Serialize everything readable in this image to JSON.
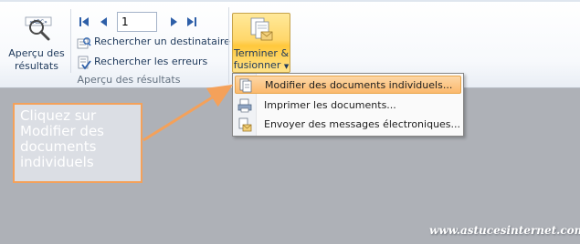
{
  "ribbon": {
    "apercu_button": {
      "line1": "Aperçu des",
      "line2": "résultats",
      "icon_text": "«ABC»"
    },
    "nav": {
      "record_value": "1"
    },
    "rechercher_destinataire": "Rechercher un destinataire",
    "rechercher_erreurs": "Rechercher les erreurs",
    "group_label": "Aperçu des résultats",
    "terminer_button": {
      "line1": "Terminer &",
      "line2": "fusionner"
    }
  },
  "dropdown": {
    "items": [
      {
        "label": "Modifier des documents individuels...",
        "icon": "edit-documents-icon",
        "highlighted": true
      },
      {
        "label": "Imprimer les documents...",
        "icon": "print-documents-icon",
        "highlighted": false
      },
      {
        "label": "Envoyer des messages électroniques...",
        "icon": "send-email-icon",
        "highlighted": false
      }
    ]
  },
  "callout": {
    "text": "Cliquez sur Modifier des documents individuels"
  },
  "watermark": "www.astucesinternet.com",
  "colors": {
    "highlight": "#fbb96d",
    "callout_border": "#f4a15a",
    "background": "#aeb1b7"
  }
}
